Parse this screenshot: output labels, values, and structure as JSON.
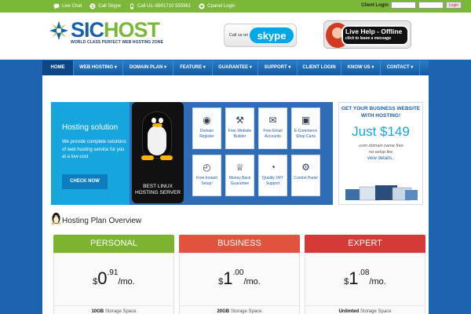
{
  "topbar": {
    "live_chat": "Live Chat",
    "call_skype": "Call Skype",
    "call_us": "Call Us:-8801710 555961",
    "cpanel_login": "Cpanel Login",
    "client_login_label": "Client Login",
    "login_button": "Login"
  },
  "header": {
    "logo_part1": "SIC",
    "logo_part2": "HOST",
    "tagline": "WORLD CLASS PERFECT WEB HOSTING ZONE",
    "skype_call_text": "Call us on",
    "skype_brand": "skype",
    "live_help_title": "Live Help - Offline",
    "live_help_sub": "click to leave a message"
  },
  "nav": {
    "items": [
      {
        "label": "HOME",
        "w": 40
      },
      {
        "label": "WEB HOSTING ▾",
        "w": 63
      },
      {
        "label": "DOMAIN PLAN ▾",
        "w": 64
      },
      {
        "label": "FEATURE ▾",
        "w": 50
      },
      {
        "label": "GUARANTEE ▾",
        "w": 58
      },
      {
        "label": "SUPPORT ▾",
        "w": 50
      },
      {
        "label": "CLIENT LOGIN",
        "w": 56
      },
      {
        "label": "KNOW US ▾",
        "w": 50
      },
      {
        "label": "CONTACT ▾",
        "w": 50
      }
    ]
  },
  "hero": {
    "title": "Hosting solution",
    "text": "We provide complete solutions of web hosting service for you at a low cost",
    "cta": "CHECK NOW",
    "tux_caption": "BEST LINUX HOSTING SERVER",
    "features": [
      {
        "label": "Domain Register",
        "icon": "globe-icon",
        "glyph": "◉"
      },
      {
        "label": "Free Website Builder",
        "icon": "tools-icon",
        "glyph": "⚒"
      },
      {
        "label": "Free Email Accounts",
        "icon": "envelope-icon",
        "glyph": "✉"
      },
      {
        "label": "E-Commerce Shop Carts",
        "icon": "cart-icon",
        "glyph": "▣"
      },
      {
        "label": "Free Instant Setup!",
        "icon": "stopwatch-icon",
        "glyph": "◴"
      },
      {
        "label": "Money Back Guarantee",
        "icon": "trophy-icon",
        "glyph": "♕"
      },
      {
        "label": "Quality 24/7 Support",
        "icon": "clock-icon",
        "glyph": "◔"
      },
      {
        "label": "Control Panel",
        "icon": "gear-icon",
        "glyph": "⚙"
      }
    ]
  },
  "promo": {
    "headline": "GET YOUR BUSINESS WEBSITE WITH HOSTING!",
    "price": "Just $149",
    "line1": ".com domain name free",
    "line2": "no setup fee",
    "link": "view details.."
  },
  "plans": {
    "title": "Hosting Plan Overview",
    "items": [
      {
        "name": "PERSONAL",
        "color": "#7cb432",
        "dollar": "$",
        "int": "0",
        "frac": ".91",
        "per": "/mo.",
        "storage_value": "10GB",
        "storage_label": "Storage Space"
      },
      {
        "name": "BUSINESS",
        "color": "#e0533d",
        "dollar": "$",
        "int": "1",
        "frac": ".00",
        "per": "/mo.",
        "storage_value": "20GB",
        "storage_label": "Storage Space"
      },
      {
        "name": "EXPERT",
        "color": "#d43b36",
        "dollar": "$",
        "int": "1",
        "frac": ".08",
        "per": "/mo.",
        "storage_value": "Unlimted",
        "storage_label": "Storage Space"
      }
    ]
  }
}
